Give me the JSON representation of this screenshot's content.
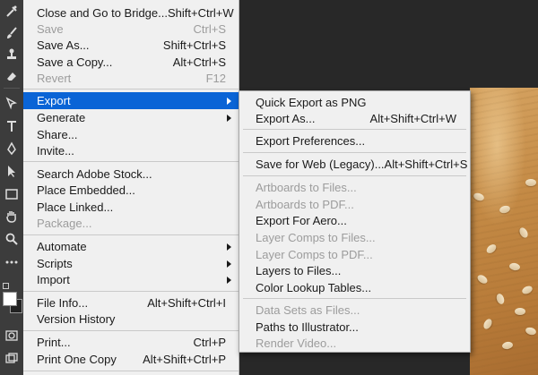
{
  "toolbar": {
    "tools": [
      "brush-heal-icon",
      "brush-icon",
      "stamp-icon",
      "eraser-icon",
      "gradient-icon",
      "type-icon",
      "pen-icon",
      "select-arrow-icon",
      "rectangle-icon",
      "hand-icon",
      "zoom-icon",
      "more-icon",
      "color-swatch-icon",
      "quick-mask-icon",
      "screen-mode-icon"
    ]
  },
  "file_menu": {
    "items": [
      {
        "label": "Close and Go to Bridge...",
        "shortcut": "Shift+Ctrl+W"
      },
      {
        "label": "Save",
        "shortcut": "Ctrl+S"
      },
      {
        "label": "Save As...",
        "shortcut": "Shift+Ctrl+S"
      },
      {
        "label": "Save a Copy...",
        "shortcut": "Alt+Ctrl+S"
      },
      {
        "label": "Revert",
        "shortcut": "F12"
      },
      {
        "label": "Export",
        "shortcut": ""
      },
      {
        "label": "Generate",
        "shortcut": ""
      },
      {
        "label": "Share...",
        "shortcut": ""
      },
      {
        "label": "Invite...",
        "shortcut": ""
      },
      {
        "label": "Search Adobe Stock...",
        "shortcut": ""
      },
      {
        "label": "Place Embedded...",
        "shortcut": ""
      },
      {
        "label": "Place Linked...",
        "shortcut": ""
      },
      {
        "label": "Package...",
        "shortcut": ""
      },
      {
        "label": "Automate",
        "shortcut": ""
      },
      {
        "label": "Scripts",
        "shortcut": ""
      },
      {
        "label": "Import",
        "shortcut": ""
      },
      {
        "label": "File Info...",
        "shortcut": "Alt+Shift+Ctrl+I"
      },
      {
        "label": "Version History",
        "shortcut": ""
      },
      {
        "label": "Print...",
        "shortcut": "Ctrl+P"
      },
      {
        "label": "Print One Copy",
        "shortcut": "Alt+Shift+Ctrl+P"
      }
    ]
  },
  "export_menu": {
    "items": [
      {
        "label": "Quick Export as PNG",
        "shortcut": ""
      },
      {
        "label": "Export As...",
        "shortcut": "Alt+Shift+Ctrl+W"
      },
      {
        "label": "Export Preferences...",
        "shortcut": ""
      },
      {
        "label": "Save for Web (Legacy)...",
        "shortcut": "Alt+Shift+Ctrl+S"
      },
      {
        "label": "Artboards to Files...",
        "shortcut": ""
      },
      {
        "label": "Artboards to PDF...",
        "shortcut": ""
      },
      {
        "label": "Export For Aero...",
        "shortcut": ""
      },
      {
        "label": "Layer Comps to Files...",
        "shortcut": ""
      },
      {
        "label": "Layer Comps to PDF...",
        "shortcut": ""
      },
      {
        "label": "Layers to Files...",
        "shortcut": ""
      },
      {
        "label": "Color Lookup Tables...",
        "shortcut": ""
      },
      {
        "label": "Data Sets as Files...",
        "shortcut": ""
      },
      {
        "label": "Paths to Illustrator...",
        "shortcut": ""
      },
      {
        "label": "Render Video...",
        "shortcut": ""
      }
    ]
  },
  "colors": {
    "highlight": "#0a64d6",
    "menu_bg": "#f0f0f0",
    "disabled_text": "#9c9c9c"
  }
}
